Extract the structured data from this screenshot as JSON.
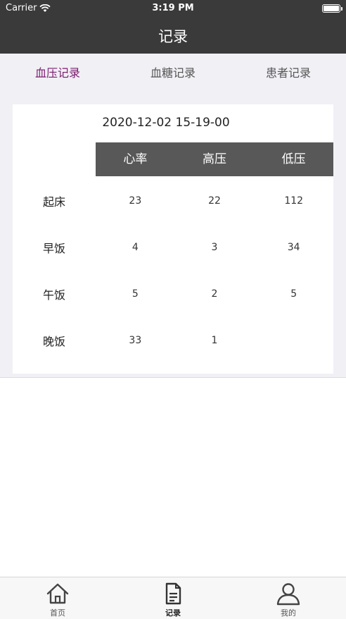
{
  "status_bar": {
    "carrier": "Carrier",
    "time": "3:19 PM"
  },
  "nav": {
    "title": "记录"
  },
  "tabs": [
    {
      "label": "血压记录",
      "active": true
    },
    {
      "label": "血糖记录",
      "active": false
    },
    {
      "label": "患者记录",
      "active": false
    }
  ],
  "record": {
    "datetime": "2020-12-02 15-19-00",
    "columns": [
      "心率",
      "高压",
      "低压"
    ],
    "rows": [
      {
        "label": "起床",
        "values": [
          "23",
          "22",
          "112"
        ]
      },
      {
        "label": "早饭",
        "values": [
          "4",
          "3",
          "34"
        ]
      },
      {
        "label": "午饭",
        "values": [
          "5",
          "2",
          "5"
        ]
      },
      {
        "label": "晚饭",
        "values": [
          "33",
          "1",
          ""
        ]
      }
    ]
  },
  "tabbar": [
    {
      "label": "首页",
      "icon": "home-icon",
      "active": false
    },
    {
      "label": "记录",
      "icon": "document-icon",
      "active": true
    },
    {
      "label": "我的",
      "icon": "person-icon",
      "active": false
    }
  ],
  "colors": {
    "nav_bg": "#3a3a3a",
    "tab_active": "#7a1b6e",
    "header_bg": "#585858",
    "page_bg": "#f1f0f5"
  }
}
